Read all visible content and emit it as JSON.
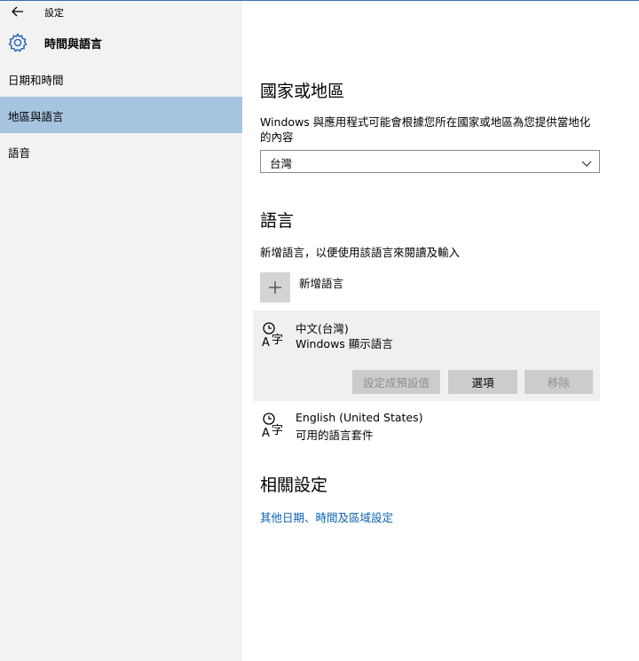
{
  "titlebar": {
    "back_icon": "back-arrow-icon",
    "title": "設定"
  },
  "header": {
    "icon": "gear-icon",
    "title": "時間與語言",
    "accent_color": "#1c5fb3"
  },
  "sidebar": {
    "items": [
      {
        "label": "日期和時間",
        "selected": false
      },
      {
        "label": "地區與語言",
        "selected": true
      },
      {
        "label": "語音",
        "selected": false
      }
    ],
    "selected_color": "#a6c4e0"
  },
  "region": {
    "title": "國家或地區",
    "description_line1": "Windows 與應用程式可能會根據您所在國家或地區為您提供當地化",
    "description_line2": "的內容",
    "selected_value": "台灣"
  },
  "language": {
    "title": "語言",
    "description": "新增語言，以便使用該語言來閱讀及輸入",
    "add_label": "新增語言",
    "entries": [
      {
        "name": "中文(台灣)",
        "status": "Windows 顯示語言",
        "actions": {
          "set_default": "設定成預設值",
          "options": "選項",
          "remove": "移除"
        }
      },
      {
        "name": "English (United States)",
        "status": "可用的語言套件"
      }
    ]
  },
  "related": {
    "title": "相關設定",
    "link": "其他日期、時間及區域設定",
    "link_color": "#0a63b4"
  }
}
